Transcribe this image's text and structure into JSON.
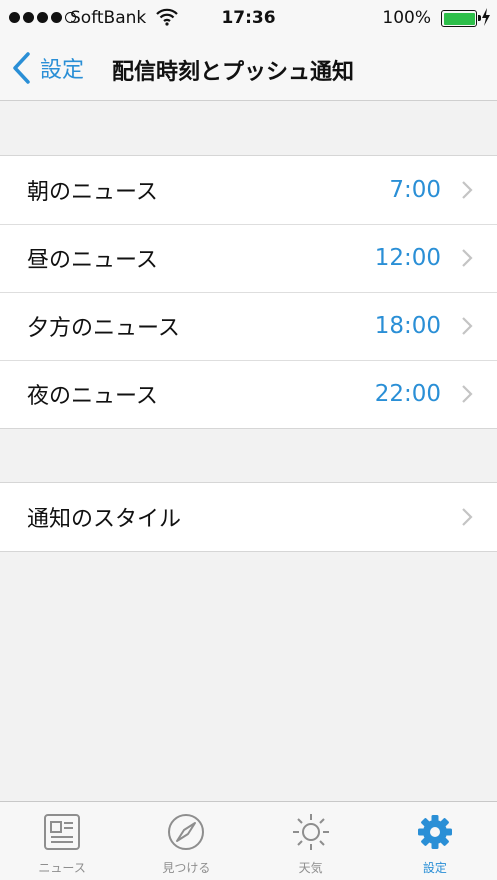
{
  "status_bar": {
    "carrier": "SoftBank",
    "time": "17:36",
    "battery": "100%",
    "battery_level": 1.0
  },
  "nav": {
    "back_label": "設定",
    "title": "配信時刻とプッシュ通知"
  },
  "schedule": [
    {
      "label": "朝のニュース",
      "value": "7:00"
    },
    {
      "label": "昼のニュース",
      "value": "12:00"
    },
    {
      "label": "夕方のニュース",
      "value": "18:00"
    },
    {
      "label": "夜のニュース",
      "value": "22:00"
    }
  ],
  "style_row": {
    "label": "通知のスタイル"
  },
  "tabs": [
    {
      "label": "ニュース",
      "icon": "newspaper-icon"
    },
    {
      "label": "見つける",
      "icon": "compass-icon"
    },
    {
      "label": "天気",
      "icon": "sun-icon"
    },
    {
      "label": "設定",
      "icon": "gear-icon"
    }
  ],
  "colors": {
    "accent": "#2a8fd6",
    "background": "#f2f2f2",
    "battery": "#2dbf4a"
  }
}
